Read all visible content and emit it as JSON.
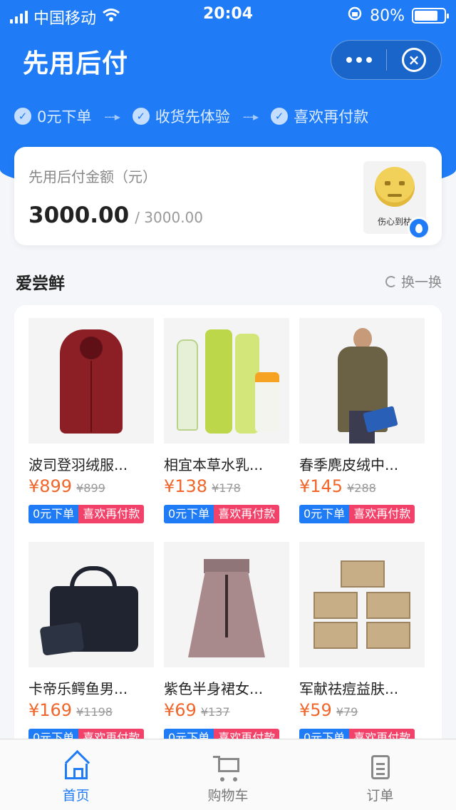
{
  "status_bar": {
    "carrier": "中国移动",
    "time": "20:04",
    "battery": "80%",
    "battery_level": 0.8,
    "icons": [
      "signal-icon",
      "wifi-icon",
      "rotation-lock-icon",
      "battery-icon"
    ]
  },
  "header": {
    "title": "先用后付",
    "menu_icon": "more-icon",
    "close_icon": "close-icon"
  },
  "steps": [
    {
      "label": "0元下单",
      "icon": "check-icon"
    },
    {
      "label": "收货先体验",
      "icon": "check-icon"
    },
    {
      "label": "喜欢再付款",
      "icon": "check-icon"
    }
  ],
  "amount": {
    "label": "先用后付金额（元）",
    "available": "3000.00",
    "total": "/ 3000.00",
    "avatar_caption": "伤心到枯"
  },
  "section": {
    "title": "爱尝鲜",
    "refresh_label": "换一换"
  },
  "products": [
    {
      "name": "波司登羽绒服...",
      "price": "¥899",
      "original": "¥899",
      "tag1": "0元下单",
      "tag2": "喜欢再付款"
    },
    {
      "name": "相宜本草水乳...",
      "price": "¥138",
      "original": "¥178",
      "tag1": "0元下单",
      "tag2": "喜欢再付款"
    },
    {
      "name": "春季麂皮绒中...",
      "price": "¥145",
      "original": "¥288",
      "tag1": "0元下单",
      "tag2": "喜欢再付款"
    },
    {
      "name": "卡帝乐鳄鱼男...",
      "price": "¥169",
      "original": "¥1198",
      "tag1": "0元下单",
      "tag2": "喜欢再付款"
    },
    {
      "name": "紫色半身裙女...",
      "price": "¥69",
      "original": "¥137",
      "tag1": "0元下单",
      "tag2": "喜欢再付款"
    },
    {
      "name": "军献祛痘益肤...",
      "price": "¥59",
      "original": "¥79",
      "tag1": "0元下单",
      "tag2": "喜欢再付款"
    }
  ],
  "tabbar": {
    "items": [
      {
        "label": "首页",
        "icon": "home-icon",
        "active": true
      },
      {
        "label": "购物车",
        "icon": "cart-icon",
        "active": false
      },
      {
        "label": "订单",
        "icon": "order-icon",
        "active": false
      }
    ]
  },
  "colors": {
    "primary": "#1f7cf6",
    "price": "#f0662a",
    "tag_blue": "#1f7cf6",
    "tag_pink": "#f2426a"
  }
}
